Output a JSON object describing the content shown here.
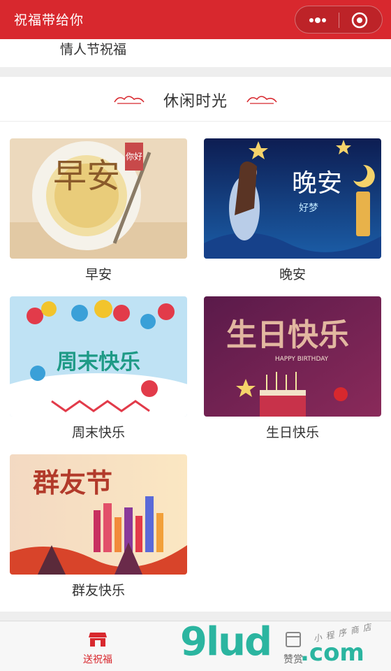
{
  "app": {
    "title": "祝福带给你"
  },
  "previous_section": {
    "label": "情人节祝福"
  },
  "section": {
    "title": "休闲时光",
    "cards": [
      {
        "label": "早安",
        "art_text": "早安",
        "art_sub": "你好"
      },
      {
        "label": "晚安",
        "art_text": "晚安",
        "art_sub": "好梦"
      },
      {
        "label": "周末快乐",
        "art_text": "周末快乐"
      },
      {
        "label": "生日快乐",
        "art_text": "生日快乐",
        "art_sub": "HAPPY BIRTHDAY"
      },
      {
        "label": "群友快乐",
        "art_text": "群友节"
      }
    ]
  },
  "tabbar": {
    "tabs": [
      {
        "label": "送祝福",
        "icon": "shop-icon",
        "active": true
      },
      {
        "label": "赞赏",
        "icon": "calendar-icon",
        "active": false
      }
    ]
  },
  "watermark": {
    "main": "9lud",
    "suffix": ".com",
    "sub": "小程序商店"
  },
  "colors": {
    "brand": "#d8282e",
    "watermark": "#2bb5a0"
  }
}
